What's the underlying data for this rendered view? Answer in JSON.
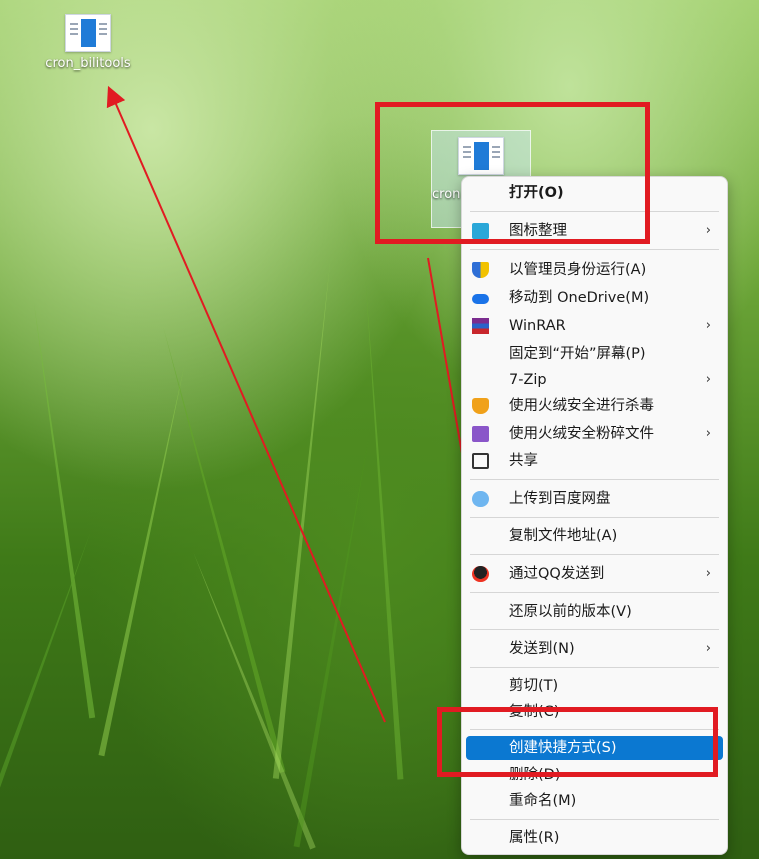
{
  "desktop": {
    "icon_top_left": "cron_bilitools",
    "icon_selected_partial": "cron"
  },
  "menu": {
    "items": [
      {
        "label": "打开(O)"
      },
      {
        "label": "图标整理"
      },
      {
        "label": "以管理员身份运行(A)"
      },
      {
        "label": "移动到 OneDrive(M)"
      },
      {
        "label": "WinRAR"
      },
      {
        "label": "固定到“开始”屏幕(P)"
      },
      {
        "label": "7-Zip"
      },
      {
        "label": "使用火绒安全进行杀毒"
      },
      {
        "label": "使用火绒安全粉碎文件"
      },
      {
        "label": "共享"
      },
      {
        "label": "上传到百度网盘"
      },
      {
        "label": "复制文件地址(A)"
      },
      {
        "label": "通过QQ发送到"
      },
      {
        "label": "还原以前的版本(V)"
      },
      {
        "label": "发送到(N)"
      },
      {
        "label": "剪切(T)"
      },
      {
        "label": "复制(C)"
      },
      {
        "label": "创建快捷方式(S)"
      },
      {
        "label": "删除(D)"
      },
      {
        "label": "重命名(M)"
      },
      {
        "label": "属性(R)"
      }
    ],
    "submenu_arrow": "›"
  },
  "colors": {
    "highlight": "#0b78d1",
    "annotation_red": "#e11b22"
  }
}
